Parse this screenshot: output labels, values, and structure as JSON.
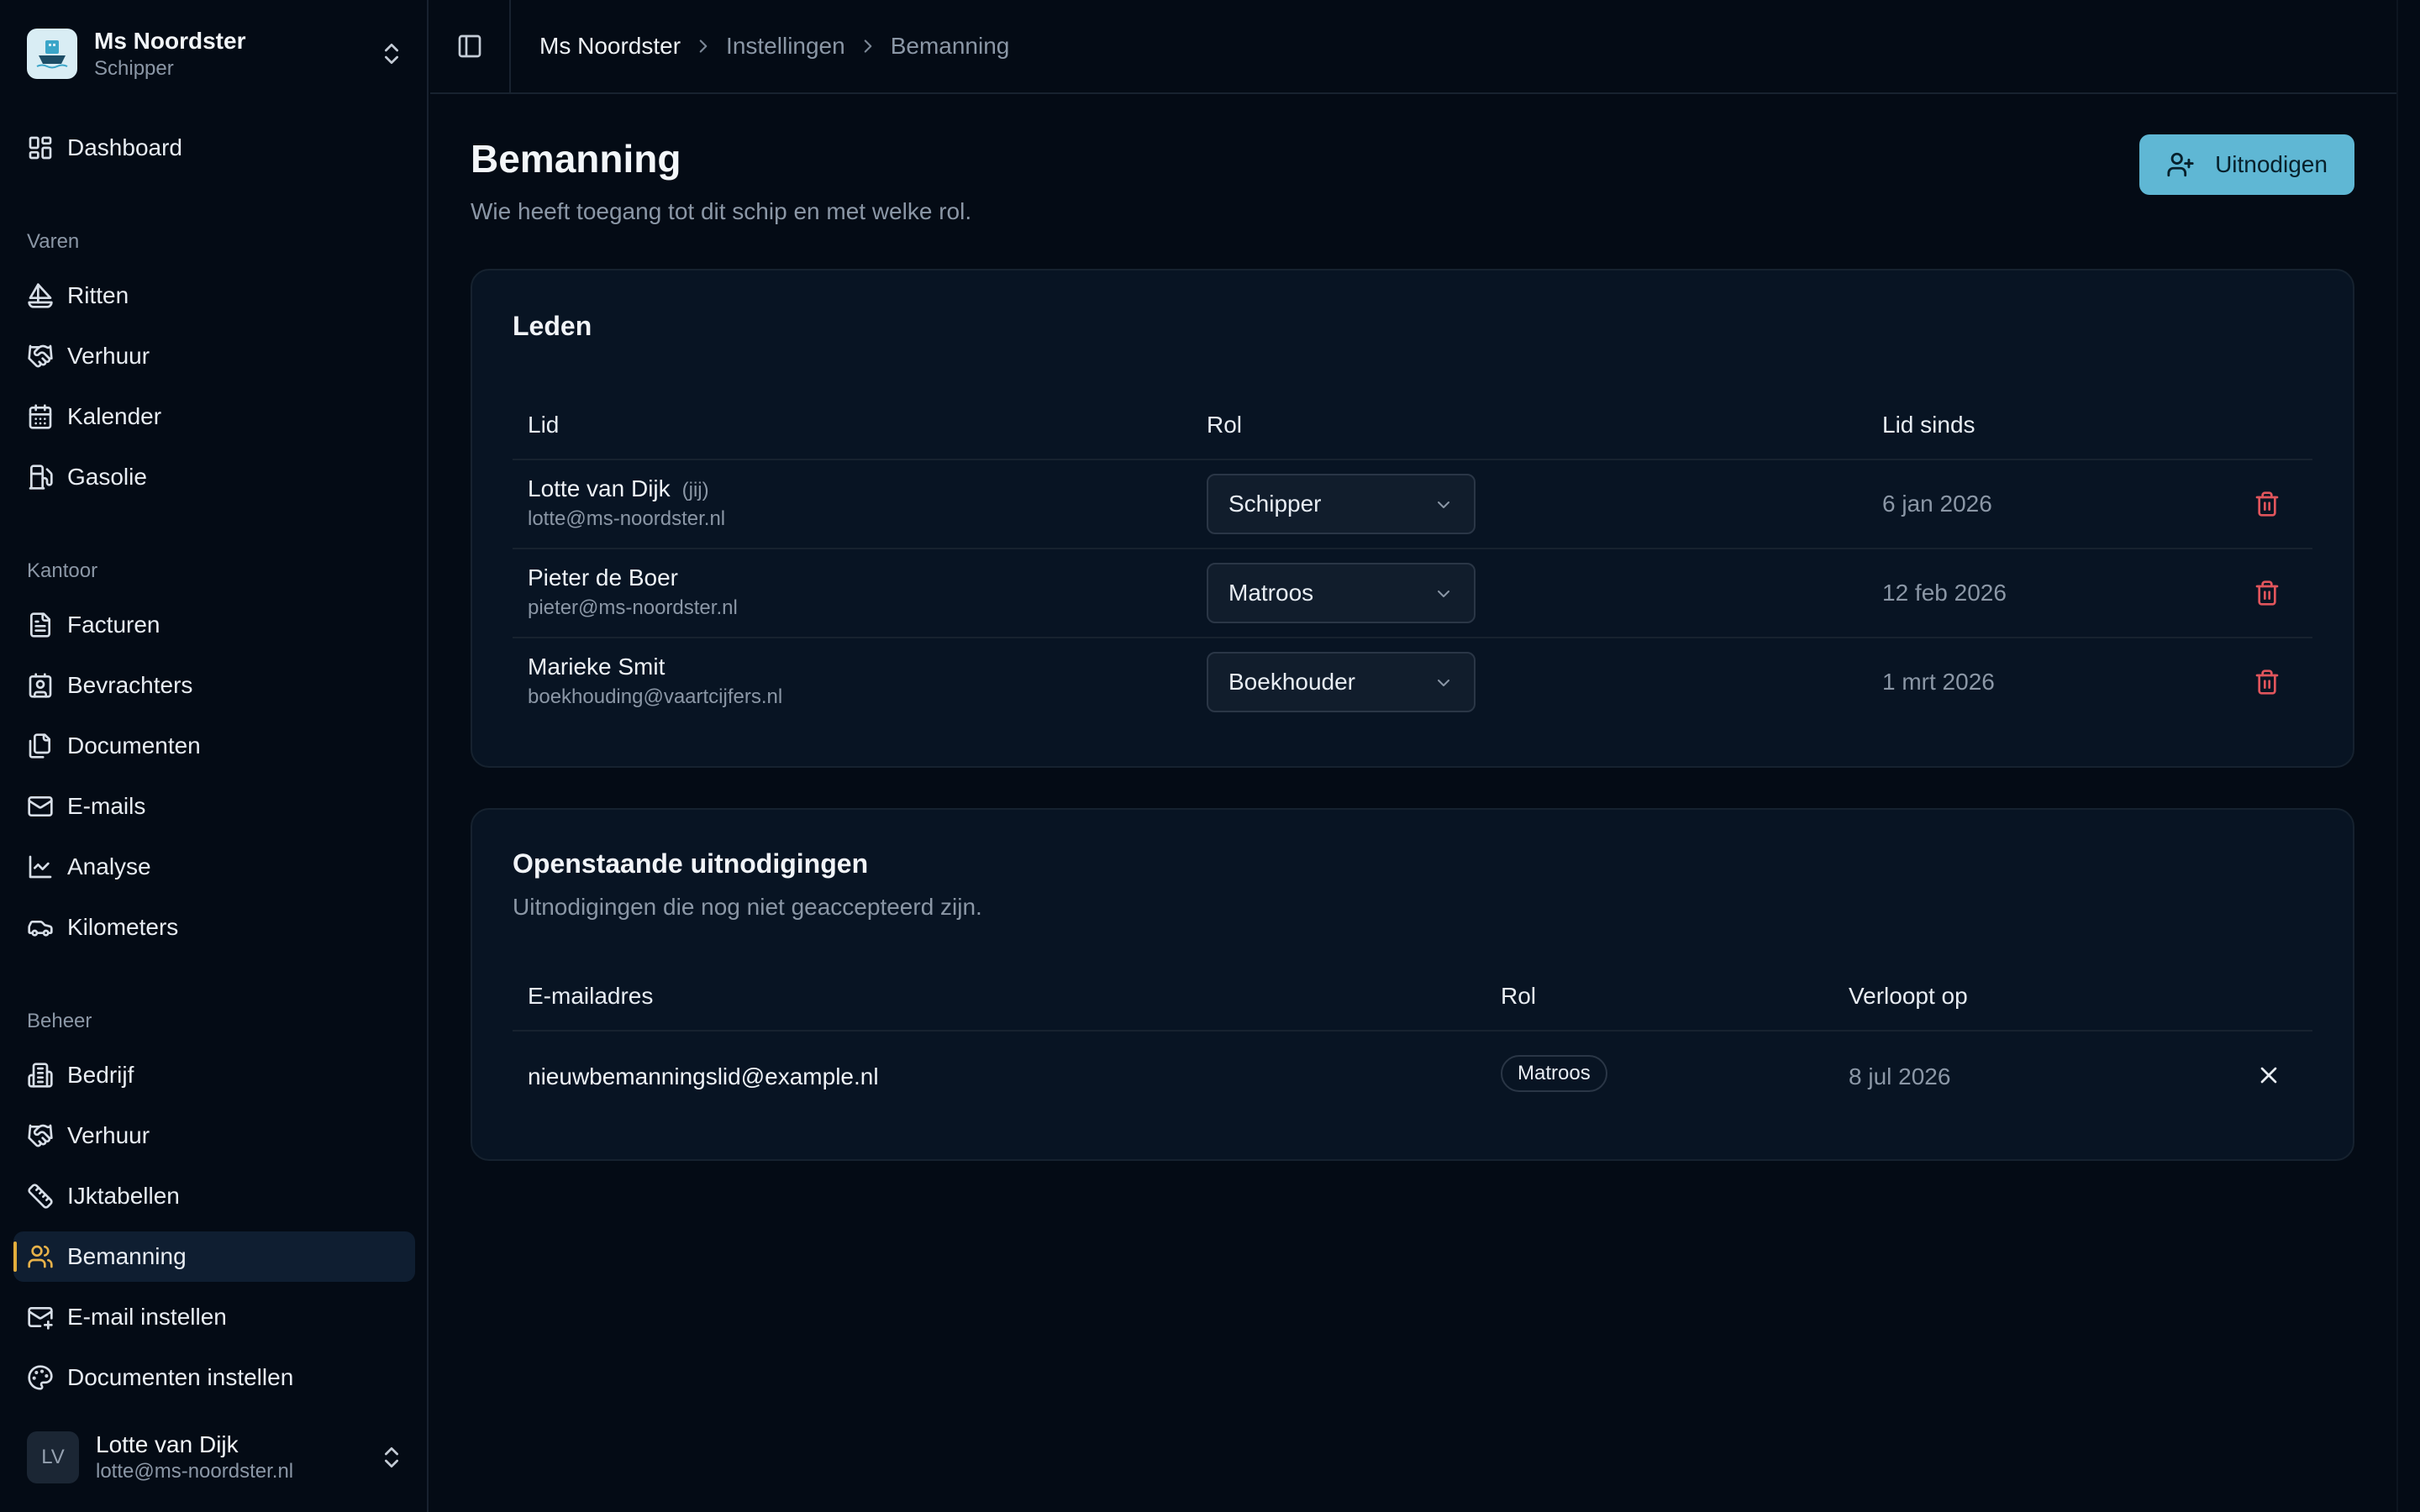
{
  "ship": {
    "name": "Ms Noordster",
    "role": "Schipper"
  },
  "nav": {
    "dashboard": "Dashboard",
    "section_varen": "Varen",
    "ritten": "Ritten",
    "verhuur": "Verhuur",
    "kalender": "Kalender",
    "gasolie": "Gasolie",
    "section_kantoor": "Kantoor",
    "facturen": "Facturen",
    "bevrachters": "Bevrachters",
    "documenten": "Documenten",
    "emails": "E-mails",
    "analyse": "Analyse",
    "kilometers": "Kilometers",
    "section_beheer": "Beheer",
    "bedrijf": "Bedrijf",
    "verhuur2": "Verhuur",
    "ijktabellen": "IJktabellen",
    "bemanning": "Bemanning",
    "email_instellen": "E-mail instellen",
    "documenten_instellen": "Documenten instellen"
  },
  "user": {
    "initials": "LV",
    "name": "Lotte van Dijk",
    "email": "lotte@ms-noordster.nl"
  },
  "breadcrumb": [
    "Ms Noordster",
    "Instellingen",
    "Bemanning"
  ],
  "page": {
    "title": "Bemanning",
    "subtitle": "Wie heeft toegang tot dit schip en met welke rol.",
    "invite_button": "Uitnodigen"
  },
  "members": {
    "title": "Leden",
    "columns": [
      "Lid",
      "Rol",
      "Lid sinds"
    ],
    "rows": [
      {
        "name": "Lotte van Dijk",
        "you": "(jij)",
        "email": "lotte@ms-noordster.nl",
        "role": "Schipper",
        "since": "6 jan 2026"
      },
      {
        "name": "Pieter de Boer",
        "you": "",
        "email": "pieter@ms-noordster.nl",
        "role": "Matroos",
        "since": "12 feb 2026"
      },
      {
        "name": "Marieke Smit",
        "you": "",
        "email": "boekhouding@vaartcijfers.nl",
        "role": "Boekhouder",
        "since": "1 mrt 2026"
      }
    ]
  },
  "invitations": {
    "title": "Openstaande uitnodigingen",
    "subtitle": "Uitnodigingen die nog niet geaccepteerd zijn.",
    "columns": [
      "E-mailadres",
      "Rol",
      "Verloopt op"
    ],
    "rows": [
      {
        "email": "nieuwbemanningslid@example.nl",
        "role": "Matroos",
        "expires": "8 jul 2026"
      }
    ]
  },
  "colors": {
    "accent": "#5fb7d4",
    "active_marker": "#e3ad3c",
    "danger": "#e0555c",
    "background": "#040b15"
  }
}
